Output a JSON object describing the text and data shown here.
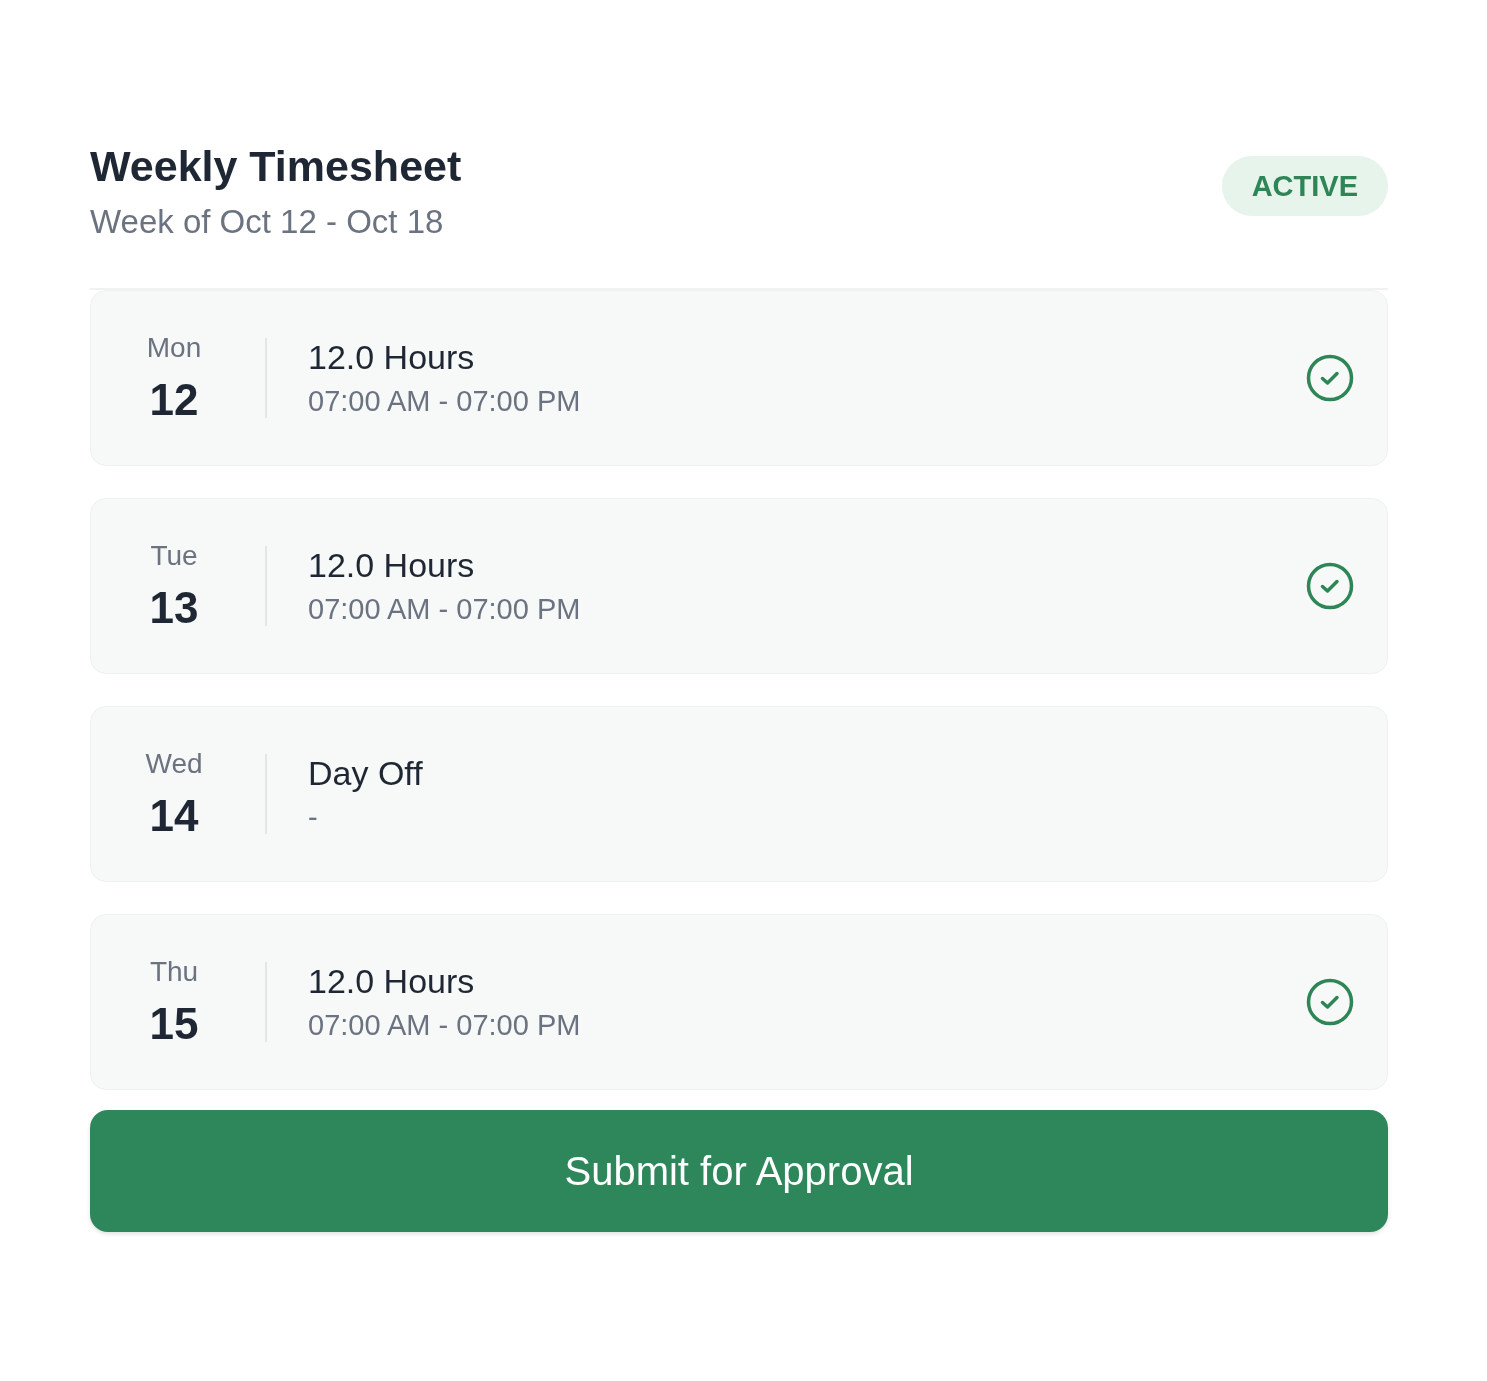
{
  "header": {
    "title": "Weekly Timesheet",
    "subtitle": "Week of Oct 12 - Oct 18",
    "status_badge": "ACTIVE"
  },
  "days": [
    {
      "weekday": "Mon",
      "date": "12",
      "title": "12.0 Hours",
      "time": "07:00 AM - 07:00 PM",
      "approved": true
    },
    {
      "weekday": "Tue",
      "date": "13",
      "title": "12.0 Hours",
      "time": "07:00 AM - 07:00 PM",
      "approved": true
    },
    {
      "weekday": "Wed",
      "date": "14",
      "title": "Day Off",
      "time": "-",
      "approved": false
    },
    {
      "weekday": "Thu",
      "date": "15",
      "title": "12.0 Hours",
      "time": "07:00 AM - 07:00 PM",
      "approved": true
    }
  ],
  "submit_button": {
    "label": "Submit for Approval"
  }
}
